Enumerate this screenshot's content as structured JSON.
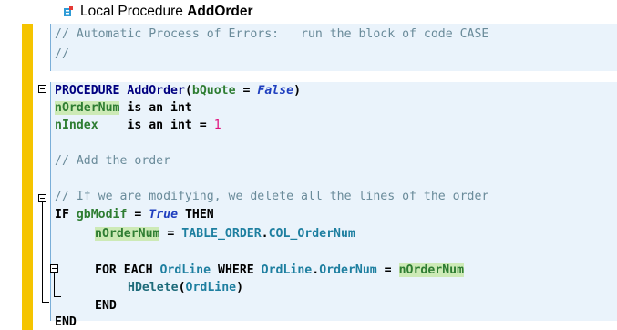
{
  "header": {
    "prefix": "Local Procedure ",
    "name": "AddOrder"
  },
  "code": {
    "comment1": "// Automatic Process of Errors:   run the block of code CASE",
    "comment2": "//",
    "proc_kw": "PROCEDURE",
    "proc_name": "AddOrder",
    "proc_open": "(",
    "proc_param": "bQuote",
    "proc_eq": " = ",
    "proc_false": "False",
    "proc_close": ")",
    "decl1_var": "nOrderNum",
    "decl1_rest": " is an int",
    "decl2_var": "nIndex",
    "decl2_rest": "    is an int = ",
    "decl2_val": "1",
    "comment3": "// Add the order",
    "comment4": "// If we are modifying, we delete all the lines of the order",
    "if_kw": "IF",
    "if_var": "gbModif",
    "if_eq": " = ",
    "if_true": "True",
    "if_then": "THEN",
    "assign_var": "nOrderNum",
    "assign_eq": " = ",
    "assign_table": "TABLE_ORDER",
    "assign_dot": ".",
    "assign_col": "COL_OrderNum",
    "for_kw": "FOR EACH",
    "for_var": "OrdLine",
    "for_where": "WHERE",
    "for_obj": "OrdLine",
    "for_dot": ".",
    "for_field": "OrderNum",
    "for_eq": " = ",
    "for_val": "nOrderNum",
    "del_fn": "HDelete",
    "del_arg": "OrdLine",
    "end1": "END",
    "end2": "END"
  }
}
